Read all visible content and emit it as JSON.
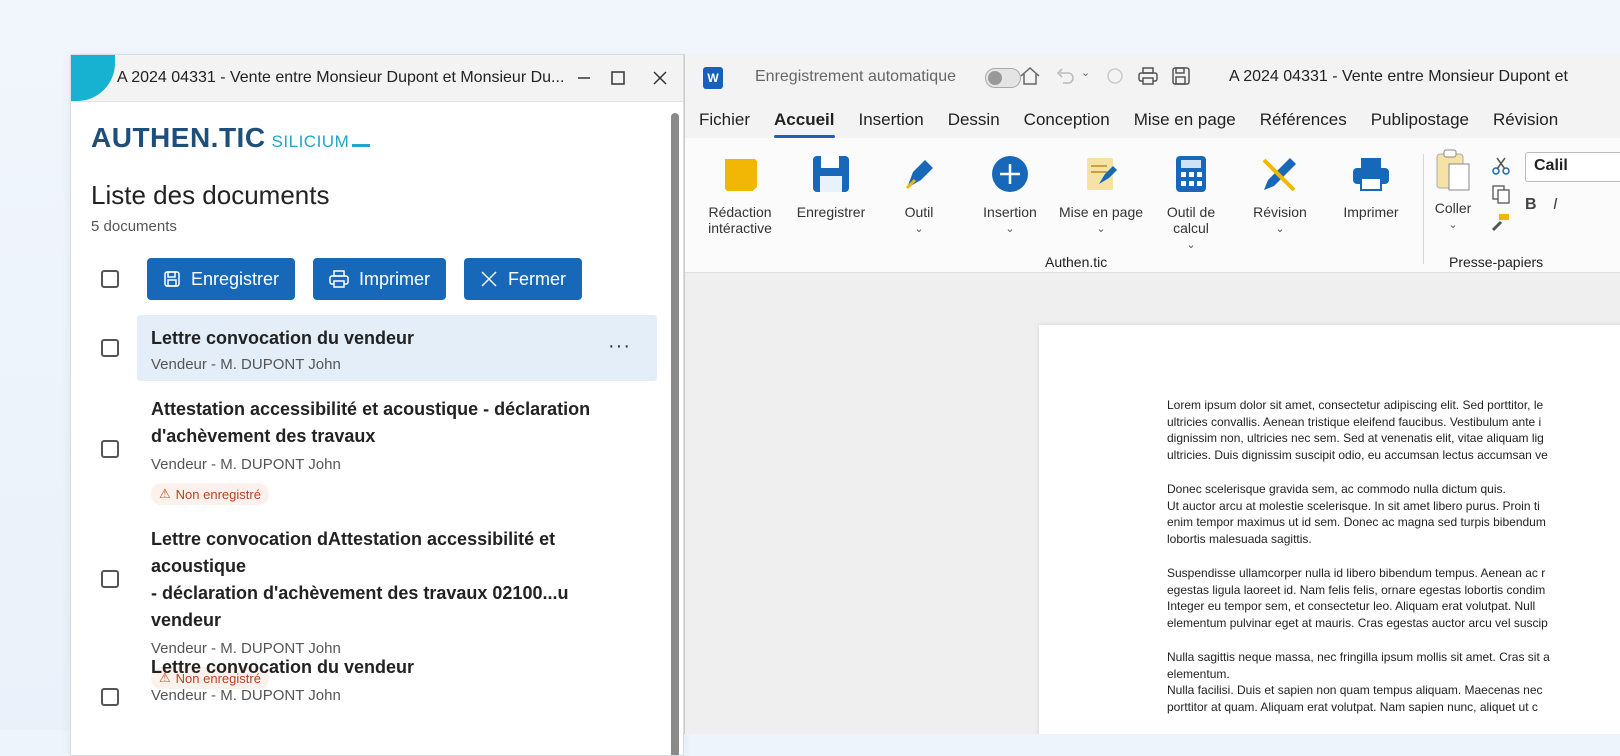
{
  "left_window": {
    "title": "A 2024 04331 - Vente entre Monsieur Dupont et Monsieur Du...",
    "logo_main": "AUTHEN.TIC",
    "logo_sub": "SILICIUM",
    "list_title": "Liste des documents",
    "doc_count": "5 documents",
    "toolbar": {
      "save": "Enregistrer",
      "print": "Imprimer",
      "close": "Fermer"
    },
    "documents": [
      {
        "title": "Lettre convocation du vendeur",
        "subtitle": "Vendeur - M. DUPONT John",
        "more": "···"
      },
      {
        "title_line1": "Attestation accessibilité et acoustique - déclaration",
        "title_line2": "d'achèvement des travaux",
        "subtitle": "Vendeur - M. DUPONT John",
        "badge": "Non enregistré"
      },
      {
        "title_line1": "Lettre convocation dAttestation accessibilité et acoustique",
        "title_line2": "- déclaration d'achèvement des travaux 02100...u vendeur",
        "subtitle": "Vendeur - M. DUPONT John",
        "badge": "Non enregistré"
      },
      {
        "title": "Lettre convocation du vendeur",
        "subtitle": "Vendeur - M. DUPONT John"
      }
    ]
  },
  "word": {
    "app_icon": "W",
    "autosave_label": "Enregistrement automatique",
    "title": "A 2024 04331 - Vente entre Monsieur Dupont et",
    "menus": [
      "Fichier",
      "Accueil",
      "Insertion",
      "Dessin",
      "Conception",
      "Mise en page",
      "Références",
      "Publipostage",
      "Révision"
    ],
    "ribbon": {
      "redaction_l1": "Rédaction",
      "redaction_l2": "intéractive",
      "enregistrer": "Enregistrer",
      "outil": "Outil",
      "insertion": "Insertion",
      "mise_en_page": "Mise en page",
      "calcul_l1": "Outil de",
      "calcul_l2": "calcul",
      "revision": "Révision",
      "imprimer": "Imprimer",
      "coller": "Coller",
      "group_authentic": "Authen.tic",
      "group_presse": "Presse-papiers",
      "font": "Calil",
      "bold": "B",
      "italic": "I"
    },
    "document_paragraphs": [
      "Lorem ipsum dolor sit amet, consectetur adipiscing elit. Sed porttitor, le\nultricies convallis. Aenean tristique eleifend faucibus. Vestibulum ante i\ndignissim non, ultricies nec sem. Sed at venenatis elit, vitae aliquam lig\nultricies. Duis dignissim suscipit odio, eu accumsan lectus accumsan ve",
      "Donec scelerisque gravida sem, ac commodo nulla dictum quis.\nUt auctor arcu at molestie scelerisque. In sit amet libero purus. Proin ti\nenim tempor maximus ut id sem. Donec ac magna sed turpis bibendum\nlobortis malesuada sagittis.",
      "Suspendisse ullamcorper nulla id libero bibendum tempus. Aenean ac r\negestas ligula laoreet id. Nam felis felis, ornare egestas lobortis condim\nInteger eu tempor sem, et consectetur leo. Aliquam erat volutpat. Null\nelementum pulvinar eget at mauris. Cras egestas auctor arcu vel suscip",
      "Nulla sagittis neque massa, nec fringilla ipsum mollis sit amet. Cras sit a\nelementum.\nNulla facilisi. Duis et sapien non quam tempus aliquam. Maecenas nec\nporttitor at quam. Aliquam erat volutpat. Nam sapien nunc, aliquet ut c"
    ]
  }
}
